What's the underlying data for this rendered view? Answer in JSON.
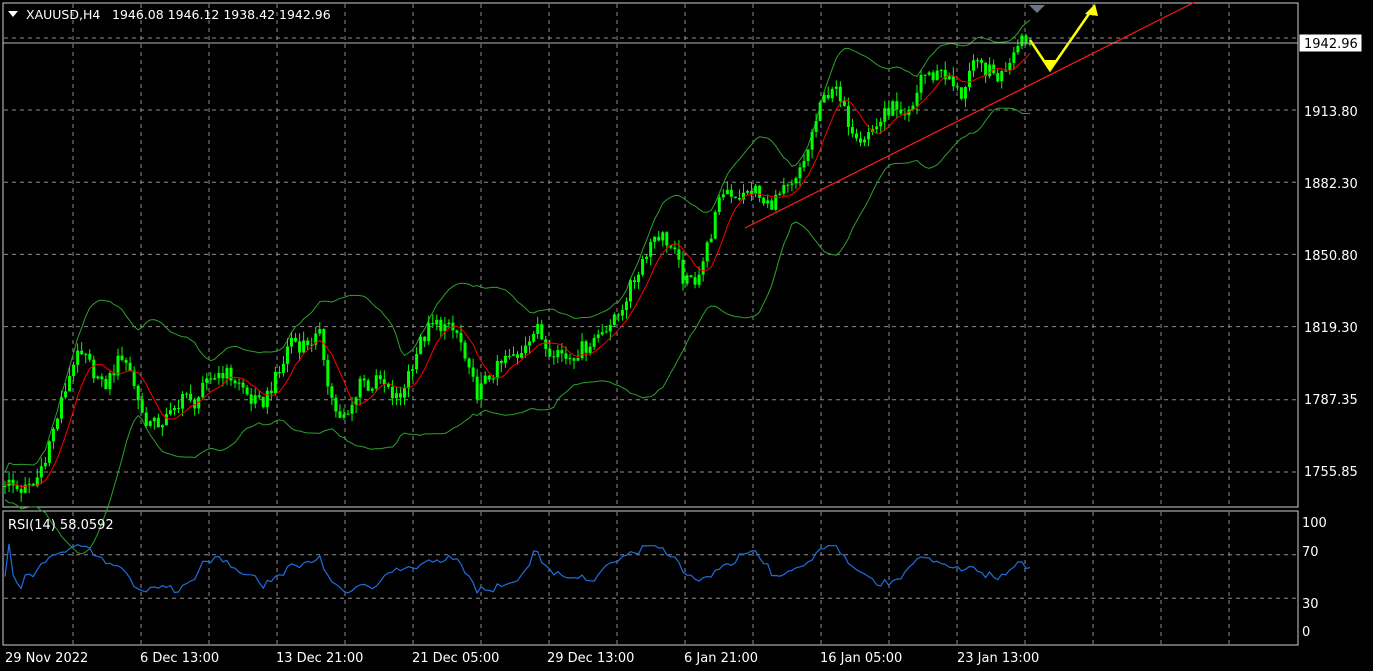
{
  "header": {
    "symbol_timeframe": "XAUUSD,H4",
    "ohlc": "1946.08 1946.12 1938.42 1942.96"
  },
  "price_panel": {
    "current_price_label": "1942.96",
    "y_tick_labels": [
      "1913.80",
      "1882.30",
      "1850.80",
      "1819.30",
      "1787.35",
      "1755.85"
    ]
  },
  "rsi_panel": {
    "title": "RSI(14) 58.0592",
    "y_tick_labels": [
      "100",
      "70",
      "30",
      "0"
    ]
  },
  "x_tick_labels": [
    "29 Nov 2022",
    "6 Dec 13:00",
    "13 Dec 21:00",
    "21 Dec 05:00",
    "29 Dec 13:00",
    "6 Jan 21:00",
    "16 Jan 05:00",
    "23 Jan 13:00"
  ],
  "colors": {
    "background": "#000000",
    "grid": "#8c8c8c",
    "candles": "#00ff00",
    "bollinger_bands": "#2ca02c",
    "moving_average": "#ff0000",
    "trendline": "#ff0000",
    "projection_arrows": "#ffff00",
    "rsi_line": "#1e6fe0",
    "text": "#ffffff"
  },
  "chart_data": [
    {
      "type": "candlestick",
      "symbol": "XAUUSD",
      "timeframe": "H4",
      "ohlc": {
        "open": 1946.08,
        "high": 1946.12,
        "low": 1938.42,
        "close": 1942.96
      },
      "current_price": 1942.96,
      "y_ticks": [
        1755.85,
        1787.35,
        1819.3,
        1850.8,
        1882.3,
        1913.8
      ],
      "y_range": [
        1742,
        1960
      ],
      "x_ticks": [
        "29 Nov 2022",
        "6 Dec 13:00",
        "13 Dec 21:00",
        "21 Dec 05:00",
        "29 Dec 13:00",
        "6 Jan 21:00",
        "16 Jan 05:00",
        "23 Jan 13:00"
      ],
      "grid": true,
      "close_series": [
        1752,
        1749,
        1748,
        1750,
        1762,
        1775,
        1790,
        1805,
        1806,
        1800,
        1792,
        1800,
        1808,
        1796,
        1780,
        1776,
        1778,
        1781,
        1790,
        1785,
        1791,
        1797,
        1800,
        1797,
        1793,
        1787,
        1785,
        1793,
        1800,
        1815,
        1811,
        1813,
        1815,
        1790,
        1778,
        1781,
        1797,
        1793,
        1796,
        1790,
        1787,
        1800,
        1811,
        1818,
        1821,
        1818,
        1816,
        1799,
        1790,
        1797,
        1801,
        1806,
        1805,
        1815,
        1818,
        1810,
        1809,
        1806,
        1808,
        1811,
        1815,
        1820,
        1822,
        1832,
        1841,
        1852,
        1860,
        1858,
        1850,
        1838,
        1840,
        1850,
        1866,
        1880,
        1877,
        1876,
        1880,
        1872,
        1874,
        1878,
        1880,
        1890,
        1905,
        1918,
        1925,
        1914,
        1906,
        1902,
        1905,
        1910,
        1916,
        1908,
        1913,
        1930,
        1928,
        1932,
        1925,
        1920,
        1932,
        1933,
        1930,
        1928,
        1937,
        1947,
        1943
      ],
      "overlays": [
        "Bollinger Bands",
        "Moving Average",
        "Ascending trendline",
        "Projection arrows"
      ]
    },
    {
      "type": "line",
      "indicator": "RSI",
      "period": 14,
      "last_value": 58.0592,
      "y_ticks": [
        0,
        30,
        70,
        100
      ],
      "y_range": [
        0,
        100
      ],
      "grid": true
    }
  ]
}
